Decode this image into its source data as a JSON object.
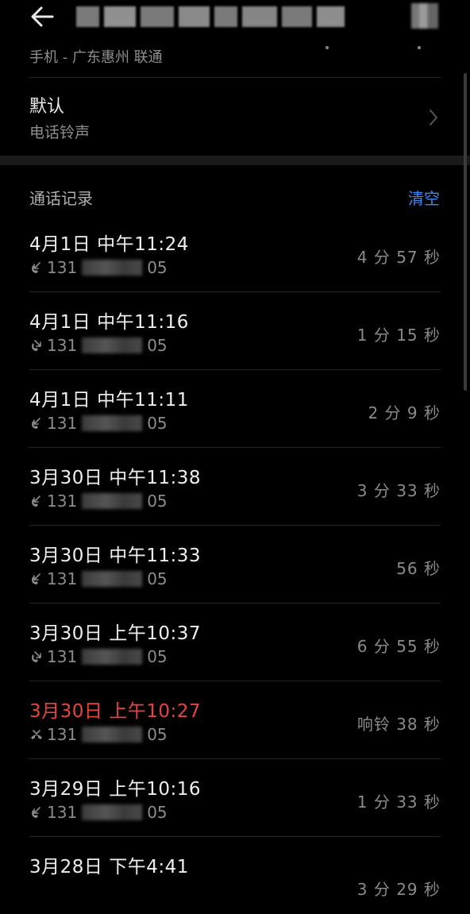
{
  "header": {
    "back_icon": "arrow-left-icon"
  },
  "contact": {
    "carrier": "手机 - 广东惠州 联通"
  },
  "ringtone": {
    "label": "默认",
    "sub": "电话铃声",
    "chevron_icon": "chevron-right-icon"
  },
  "call_log": {
    "header": "通话记录",
    "clear_label": "清空",
    "accent_color": "#3f87f5",
    "missed_color": "#e5453c",
    "rows": [
      {
        "datetime": "4月1日 中午11:24",
        "number_prefix": "131",
        "number_suffix": "05",
        "duration": "4 分 57 秒",
        "type": "incoming",
        "icon": "phone-incoming-icon"
      },
      {
        "datetime": "4月1日 中午11:16",
        "number_prefix": "131",
        "number_suffix": "05",
        "duration": "1 分 15 秒",
        "type": "outgoing",
        "icon": "phone-outgoing-icon"
      },
      {
        "datetime": "4月1日 中午11:11",
        "number_prefix": "131",
        "number_suffix": "05",
        "duration": "2 分 9 秒",
        "type": "incoming",
        "icon": "phone-incoming-icon"
      },
      {
        "datetime": "3月30日 中午11:38",
        "number_prefix": "131",
        "number_suffix": "05",
        "duration": "3 分 33 秒",
        "type": "incoming",
        "icon": "phone-incoming-icon"
      },
      {
        "datetime": "3月30日 中午11:33",
        "number_prefix": "131",
        "number_suffix": "05",
        "duration": "56 秒",
        "type": "incoming",
        "icon": "phone-incoming-icon"
      },
      {
        "datetime": "3月30日 上午10:37",
        "number_prefix": "131",
        "number_suffix": "05",
        "duration": "6 分 55 秒",
        "type": "outgoing",
        "icon": "phone-outgoing-icon"
      },
      {
        "datetime": "3月30日 上午10:27",
        "number_prefix": "131",
        "number_suffix": "05",
        "duration": "响铃 38 秒",
        "type": "missed",
        "icon": "phone-missed-icon"
      },
      {
        "datetime": "3月29日 上午10:16",
        "number_prefix": "131",
        "number_suffix": "05",
        "duration": "1 分 33 秒",
        "type": "incoming",
        "icon": "phone-incoming-icon"
      },
      {
        "datetime": "3月28日 下午4:41",
        "number_prefix": "",
        "number_suffix": "",
        "duration": "3 分 29 秒",
        "type": "incoming",
        "icon": "phone-incoming-icon"
      }
    ]
  }
}
